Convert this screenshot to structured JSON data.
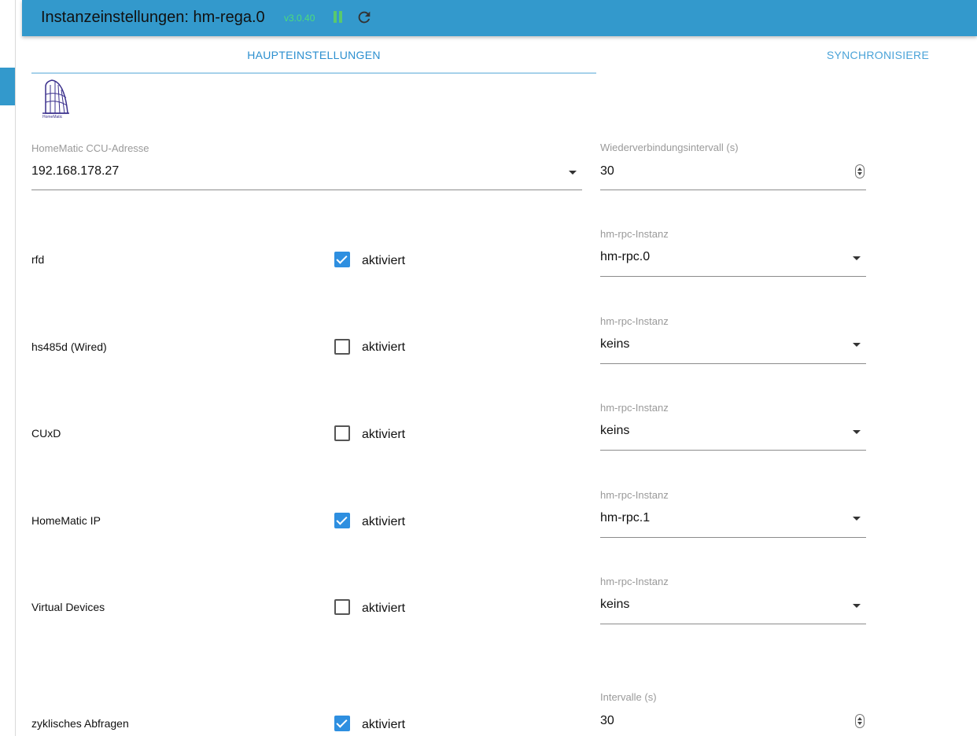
{
  "header": {
    "title": "Instanzeinstellungen: hm-rega.0",
    "version": "v3.0.40"
  },
  "tabs": [
    {
      "label": "HAUPTEINSTELLUNGEN",
      "active": true
    },
    {
      "label": "SYNCHRONISIERE",
      "active": false
    }
  ],
  "logo": {
    "text": "HomeMatic"
  },
  "ccu": {
    "label": "HomeMatic CCU-Adresse",
    "value": "192.168.178.27"
  },
  "reconnect": {
    "label": "Wiederverbindungsintervall (s)",
    "value": "30"
  },
  "rows": [
    {
      "label": "rfd",
      "checkbox_label": "aktiviert",
      "checked": true,
      "instance_label": "hm-rpc-Instanz",
      "instance_value": "hm-rpc.0"
    },
    {
      "label": "hs485d (Wired)",
      "checkbox_label": "aktiviert",
      "checked": false,
      "instance_label": "hm-rpc-Instanz",
      "instance_value": "keins"
    },
    {
      "label": "CUxD",
      "checkbox_label": "aktiviert",
      "checked": false,
      "instance_label": "hm-rpc-Instanz",
      "instance_value": "keins"
    },
    {
      "label": "HomeMatic IP",
      "checkbox_label": "aktiviert",
      "checked": true,
      "instance_label": "hm-rpc-Instanz",
      "instance_value": "hm-rpc.1"
    },
    {
      "label": "Virtual Devices",
      "checkbox_label": "aktiviert",
      "checked": false,
      "instance_label": "hm-rpc-Instanz",
      "instance_value": "keins"
    }
  ],
  "polling": {
    "label": "zyklisches Abfragen",
    "checkbox_label": "aktiviert",
    "checked": true,
    "interval_label": "Intervalle (s)",
    "interval_value": "30"
  },
  "colors": {
    "accent": "#3399cc",
    "checkbox_on": "#2e8fe0",
    "version": "#4ddc7a"
  }
}
